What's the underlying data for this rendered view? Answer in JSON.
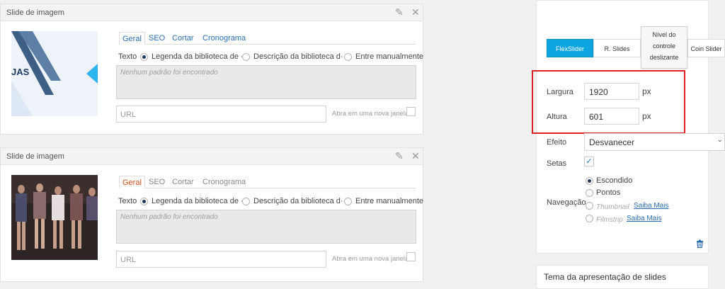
{
  "slides": [
    {
      "title": "Slide de imagem",
      "thumb_text": "JAS",
      "tabs": [
        "Geral",
        "SEO",
        "Cortar",
        "Cronograma"
      ],
      "texto_label": "Texto",
      "radio_options": [
        "Legenda da biblioteca de ···",
        "Descrição da biblioteca d···",
        "Entre manualmente"
      ],
      "textarea_placeholder": "Nenhum padrão foi encontrado",
      "url_placeholder": "URL",
      "new_window_label": "Abra em uma nova janela"
    },
    {
      "title": "Slide de imagem",
      "tabs": [
        "Geral",
        "SEO",
        "Cortar",
        "Cronograma"
      ],
      "texto_label": "Texto",
      "radio_options": [
        "Legenda da biblioteca de ···",
        "Descrição da biblioteca d···",
        "Entre manualmente"
      ],
      "textarea_placeholder": "Nenhum padrão foi encontrado",
      "url_placeholder": "URL",
      "new_window_label": "Abra em uma nova janela"
    }
  ],
  "settings": {
    "slider_types": [
      "FlexSlider",
      "R. Slides",
      "Coin Slider"
    ],
    "tooltip_lines": [
      "Nível do",
      "controle",
      "deslizante"
    ],
    "largura_label": "Largura",
    "largura_value": "1920",
    "altura_label": "Altura",
    "altura_value": "601",
    "px": "px",
    "efeito_label": "Efeito",
    "efeito_value": "Desvanecer",
    "setas_label": "Setas",
    "navegacao_label": "Navegação",
    "nav_options": [
      "Escondido",
      "Pontos",
      "Thumbnail",
      "Filmstrip"
    ],
    "saiba_mais": "Saiba Mais"
  },
  "theme_title": "Tema da apresentação de slides",
  "colors": {
    "accent": "#0da5e1",
    "highlight": "#e01e24",
    "link": "#2a6db0"
  }
}
